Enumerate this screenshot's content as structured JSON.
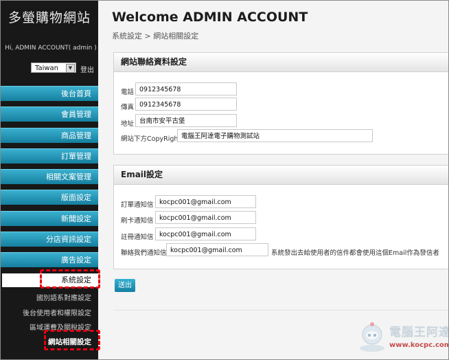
{
  "sidebar": {
    "brand": "多螢購物網站",
    "greeting": "Hi, ADMIN ACCOUNT( admin )",
    "language": "Taiwan",
    "logout": "登出",
    "menu": [
      "後台首頁",
      "會員管理",
      "商品管理",
      "訂單管理",
      "相關文案管理",
      "版面設定",
      "新聞設定",
      "分店資訊設定",
      "廣告設定"
    ],
    "active_item": "系統設定",
    "sub_items": [
      "國別語系對應設定",
      "後台使用者和權限設定",
      "區域運費及關稅設定",
      "網站相關設定"
    ]
  },
  "header": {
    "title": "Welcome ADMIN ACCOUNT",
    "breadcrumb": "系統設定 > 網站相關設定"
  },
  "contact": {
    "heading": "網站聯絡資料設定",
    "phone_label": "電話",
    "phone_value": "0912345678",
    "fax_label": "傳真",
    "fax_value": "0912345678",
    "address_label": "地址",
    "address_value": "台南市安平古堡",
    "copyright_label": "網站下方CopyRight",
    "copyright_value": "電腦王阿達電子購物測試站"
  },
  "email": {
    "heading": "Email設定",
    "order_label": "訂單通知信",
    "order_value": "kocpc001@gmail.com",
    "card_label": "刷卡通知信",
    "card_value": "kocpc001@gmail.com",
    "register_label": "註冊通知信",
    "register_value": "kocpc001@gmail.com",
    "contact_label": "聯絡我們通知信",
    "contact_value": "kocpc001@gmail.com",
    "note": "系統發出去給使用者的信件都會使用這個Email作為發信者"
  },
  "actions": {
    "submit": "送出"
  },
  "watermark": {
    "name": "電腦王阿達",
    "url": "www.kocpc.com.tw"
  },
  "colors": {
    "accent": "#1f95b8",
    "highlight": "#e60012",
    "sidebar_bg": "#181818"
  }
}
